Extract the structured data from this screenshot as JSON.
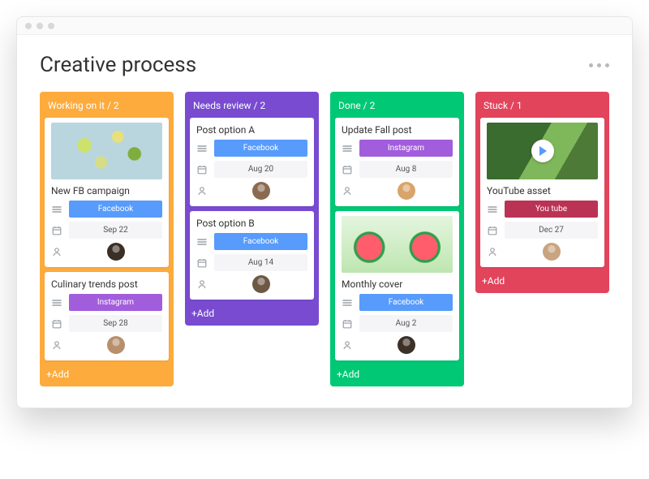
{
  "header": {
    "title": "Creative process"
  },
  "add_label": "+Add",
  "columns": [
    {
      "title": "Working on it / 2",
      "color": "col-orange",
      "cards": [
        {
          "title": "New FB campaign",
          "thumb": "citrus",
          "platform": "Facebook",
          "platform_color": "pill-blue",
          "date": "Sep 22",
          "avatar": "#3a2e25"
        },
        {
          "title": "Culinary trends post",
          "platform": "Instagram",
          "platform_color": "pill-purple",
          "date": "Sep 28",
          "avatar": "#b78f6c"
        }
      ]
    },
    {
      "title": "Needs review / 2",
      "color": "col-purple",
      "cards": [
        {
          "title": "Post option A",
          "platform": "Facebook",
          "platform_color": "pill-blue",
          "date": "Aug 20",
          "avatar": "#8a6a50"
        },
        {
          "title": "Post option B",
          "platform": "Facebook",
          "platform_color": "pill-blue",
          "date": "Aug 14",
          "avatar": "#6d5844"
        }
      ]
    },
    {
      "title": "Done / 2",
      "color": "col-green",
      "cards": [
        {
          "title": "Update Fall post",
          "platform": "Instagram",
          "platform_color": "pill-purple",
          "date": "Aug 8",
          "avatar": "#d9a46a"
        },
        {
          "title": "Monthly cover",
          "thumb": "watermelon",
          "platform": "Facebook",
          "platform_color": "pill-blue",
          "date": "Aug 2",
          "avatar": "#3d3027"
        }
      ]
    },
    {
      "title": "Stuck / 1",
      "color": "col-pink",
      "cards": [
        {
          "title": "YouTube asset",
          "thumb": "video",
          "platform": "You tube",
          "platform_color": "pill-red",
          "date": "Dec 27",
          "avatar": "#c9a480"
        }
      ]
    }
  ]
}
